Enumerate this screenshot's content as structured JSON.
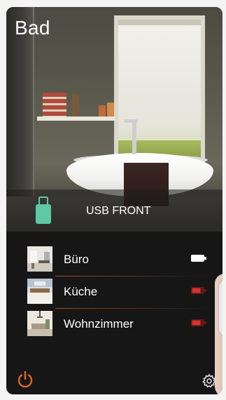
{
  "header": {
    "room_title": "Bad"
  },
  "source": {
    "label": "USB FRONT",
    "icon": "usb-stick-icon",
    "icon_color": "#5fc8a4"
  },
  "speakers": [
    {
      "name": "Büro",
      "thumb": "office-room-thumbnail",
      "battery_color": "#ffffff"
    },
    {
      "name": "Küche",
      "thumb": "kitchen-room-thumbnail",
      "battery_color": "#d6322d"
    },
    {
      "name": "Wohnzimmer",
      "thumb": "living-room-thumbnail",
      "battery_color": "#d6322d"
    }
  ],
  "footer": {
    "power_icon": "power-icon",
    "settings_icon": "gear-icon"
  },
  "colors": {
    "accent": "#e0662a",
    "background": "#161616",
    "text": "#ffffff"
  }
}
